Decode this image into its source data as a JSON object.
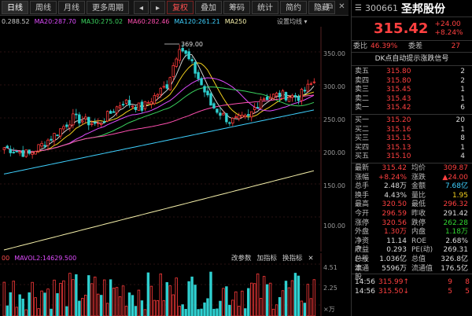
{
  "toolbar": {
    "items": [
      "日线",
      "周线",
      "月线",
      "更多周期",
      "复权",
      "叠加",
      "筹码",
      "统计",
      "简约",
      "隐藏"
    ],
    "active": "日线",
    "nav_left": "◂",
    "nav_right": "▸"
  },
  "window_controls": [
    "⧉",
    "✕"
  ],
  "ma_legend": [
    {
      "label": "0.288.52",
      "color": "#cfcfcf"
    },
    {
      "label": "MA20:287.70",
      "color": "#e04cff"
    },
    {
      "label": "MA30:275.02",
      "color": "#3bd35f"
    },
    {
      "label": "MA60:282.46",
      "color": "#ff4fb0"
    },
    {
      "label": "MA120:261.21",
      "color": "#3fd1ff"
    },
    {
      "label": "MA250",
      "color": "#f5f0aa"
    }
  ],
  "ma_settings": "设置均线 ▾",
  "price_axis": [
    "350.00",
    "300.00",
    "250.00",
    "200.00",
    "150.00",
    "100.00"
  ],
  "high_marker": "369.00",
  "volume": {
    "header": "MAVOL2:14629.500",
    "header_prefix": "00",
    "tools": [
      "改参数",
      "加指标",
      "换指标",
      "✕"
    ],
    "axis": [
      "4.51",
      "2.25",
      "×万"
    ]
  },
  "stock": {
    "code": "300661",
    "name": "圣邦股份",
    "price": "315.42",
    "change": "+24.00",
    "change_pct": "+8.24%",
    "weibi_label": "委比",
    "weibi": "46.39%",
    "weicha_label": "委差",
    "weicha": "27",
    "signal": "DK点自动提示涨跌信号"
  },
  "asks": [
    {
      "label": "卖五",
      "price": "315.80",
      "vol": "2"
    },
    {
      "label": "卖四",
      "price": "315.80",
      "vol": "2"
    },
    {
      "label": "卖三",
      "price": "315.45",
      "vol": "1"
    },
    {
      "label": "卖二",
      "price": "315.43",
      "vol": "1"
    },
    {
      "label": "卖一",
      "price": "315.42",
      "vol": "6"
    }
  ],
  "bids": [
    {
      "label": "买一",
      "price": "315.20",
      "vol": "20"
    },
    {
      "label": "买二",
      "price": "315.16",
      "vol": "1"
    },
    {
      "label": "买三",
      "price": "315.15",
      "vol": "8"
    },
    {
      "label": "买四",
      "price": "315.13",
      "vol": "1"
    },
    {
      "label": "买五",
      "price": "315.10",
      "vol": "4"
    }
  ],
  "stats": [
    {
      "k": "最新",
      "v": "315.42",
      "vc": "red",
      "k2": "均价",
      "v2": "309.87",
      "v2c": "red"
    },
    {
      "k": "涨幅",
      "v": "+8.24%",
      "vc": "red",
      "k2": "涨跌",
      "v2": "▲24.00",
      "v2c": "red"
    },
    {
      "k": "总手",
      "v": "2.48万",
      "vc": "white",
      "k2": "金额",
      "v2": "7.68亿",
      "v2c": "cyan"
    },
    {
      "k": "换手",
      "v": "4.43%",
      "vc": "white",
      "k2": "量比",
      "v2": "1.95",
      "v2c": "yellow"
    },
    {
      "k": "最高",
      "v": "320.50",
      "vc": "red",
      "k2": "最低",
      "v2": "296.32",
      "v2c": "red"
    },
    {
      "k": "今开",
      "v": "296.59",
      "vc": "red",
      "k2": "昨收",
      "v2": "291.42",
      "v2c": "white"
    },
    {
      "k": "涨停",
      "v": "320.56",
      "vc": "red",
      "k2": "跌停",
      "v2": "262.28",
      "v2c": "green"
    },
    {
      "k": "外盘",
      "v": "1.30万",
      "vc": "red",
      "k2": "内盘",
      "v2": "1.18万",
      "v2c": "green"
    },
    {
      "k": "净资产",
      "v": "11.14",
      "vc": "white",
      "k2": "ROE",
      "v2": "2.68%",
      "v2c": "white"
    },
    {
      "k": "收益(一)",
      "v": "0.293",
      "vc": "white",
      "k2": "PE(动)",
      "v2": "269.31",
      "v2c": "white"
    },
    {
      "k": "总股本",
      "v": "1.036亿",
      "vc": "white",
      "k2": "总值",
      "v2": "326.8亿",
      "v2c": "white"
    },
    {
      "k": "流通股",
      "v": "5596万",
      "vc": "white",
      "k2": "流通值",
      "v2": "176.5亿",
      "v2c": "white"
    }
  ],
  "ticks": [
    {
      "t": "14:56",
      "p": "315.99",
      "arrow": "↑",
      "v": "9",
      "n": "8"
    },
    {
      "t": "14:56",
      "p": "315.50",
      "arrow": "↓",
      "v": "5",
      "n": "5"
    }
  ]
}
